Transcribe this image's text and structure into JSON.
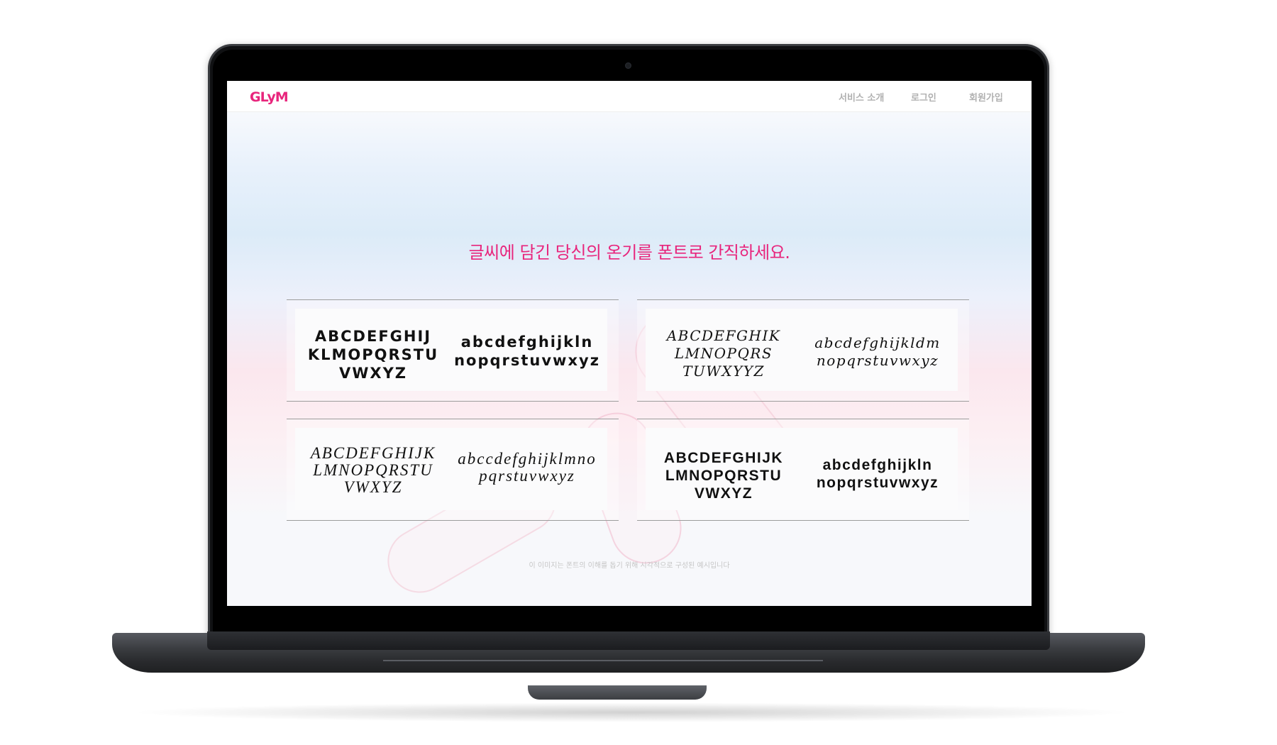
{
  "site": {
    "logo": "GLyM",
    "brand_color": "#e8257c"
  },
  "nav": {
    "service": "서비스 소개",
    "login": "로그인",
    "signup": "회원가입"
  },
  "hero": {
    "headline": "글씨에 담긴 당신의 온기를 폰트로 간직하세요.",
    "caption": "이 이미지는 폰트의 이해를 돕기 위해 시각적으로 구성된 예시입니다"
  },
  "samples": [
    {
      "upper": "ABCDEFGHIJ\nKLMOPQRSTU\nVWXYZ",
      "lower": "abcdefghijkln\nnopqrstuvwxyz"
    },
    {
      "upper": "ABCDEFGHIK\nLMNOPQRS\nTUWXYYZ",
      "lower": "abcdefghijkldm\nnopqrstuvwxyz"
    },
    {
      "upper": "ABCDEFGHIJK\nLMNOPQRSTU\nVWXYZ",
      "lower": "abccdefghijklmno\npqrstuvwxyz"
    },
    {
      "upper": "ABCDEFGHIJK\nLMNOPQRSTU\nVWXYZ",
      "lower": "abcdefghijkln\nnopqrstuvwxyz"
    }
  ]
}
